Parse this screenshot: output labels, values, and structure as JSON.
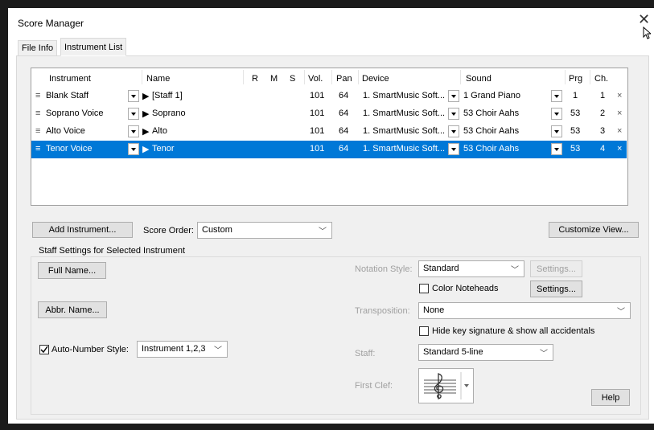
{
  "window": {
    "title": "Score Manager",
    "close_glyph": "✕"
  },
  "tabs": [
    "File Info",
    "Instrument List"
  ],
  "grid": {
    "headers": [
      "Instrument",
      "Name",
      "R",
      "M",
      "S",
      "Vol.",
      "Pan",
      "Device",
      "Sound",
      "Prg",
      "Ch."
    ],
    "rows": [
      {
        "instrument": "Blank Staff",
        "name": "[Staff 1]",
        "vol": "101",
        "pan": "64",
        "device": "1. SmartMusic Soft...",
        "sound": "1 Grand Piano",
        "prg": "1",
        "ch": "1",
        "selected": false
      },
      {
        "instrument": "Soprano Voice",
        "name": "Soprano",
        "vol": "101",
        "pan": "64",
        "device": "1. SmartMusic Soft...",
        "sound": "53 Choir Aahs",
        "prg": "53",
        "ch": "2",
        "selected": false
      },
      {
        "instrument": "Alto Voice",
        "name": "Alto",
        "vol": "101",
        "pan": "64",
        "device": "1. SmartMusic Soft...",
        "sound": "53 Choir Aahs",
        "prg": "53",
        "ch": "3",
        "selected": false
      },
      {
        "instrument": "Tenor Voice",
        "name": "Tenor",
        "vol": "101",
        "pan": "64",
        "device": "1. SmartMusic Soft...",
        "sound": "53 Choir Aahs",
        "prg": "53",
        "ch": "4",
        "selected": true
      }
    ],
    "remove_glyph": "×",
    "drag_glyph": "≡",
    "play_glyph": "▶"
  },
  "toolbar": {
    "add_instrument": "Add Instrument...",
    "score_order_label": "Score Order:",
    "score_order_value": "Custom",
    "customize_view": "Customize View..."
  },
  "staff_settings": {
    "group_label": "Staff Settings for Selected Instrument",
    "full_name": "Full Name...",
    "abbr_name": "Abbr. Name...",
    "auto_number_label": "Auto-Number Style:",
    "auto_number_value": "Instrument 1,2,3",
    "auto_number_checked": true,
    "notation_style_label": "Notation Style:",
    "notation_style_value": "Standard",
    "settings_disabled": "Settings...",
    "color_noteheads": "Color Noteheads",
    "settings": "Settings...",
    "transposition_label": "Transposition:",
    "transposition_value": "None",
    "hide_key_sig": "Hide key signature & show all accidentals",
    "staff_label": "Staff:",
    "staff_value": "Standard 5-line",
    "first_clef_label": "First Clef:",
    "help": "Help"
  },
  "colors": {
    "selection": "#0078d7",
    "panel": "#f0f0f0",
    "accent_text": "#ffffff"
  }
}
